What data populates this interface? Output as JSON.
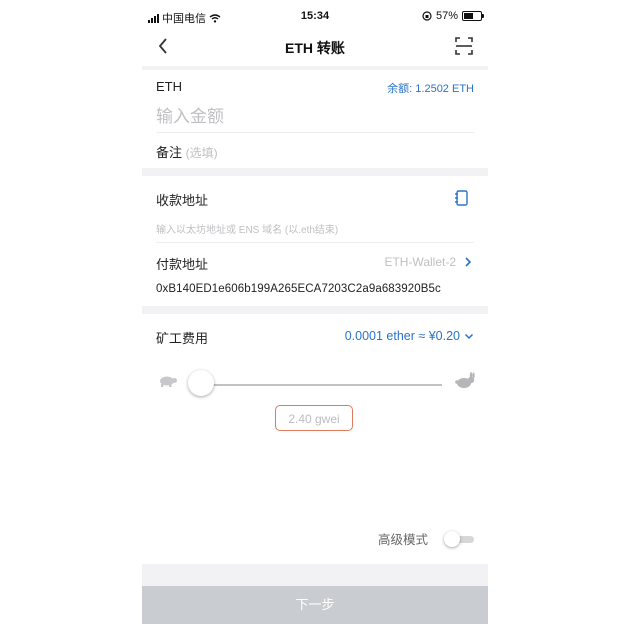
{
  "status_bar": {
    "carrier": "中国电信",
    "time": "15:34",
    "battery": "57%",
    "battery_level": 0.57
  },
  "header": {
    "title": "ETH 转账",
    "back_icon": "chevron-left-icon",
    "scan_icon": "scan-icon"
  },
  "amount": {
    "currency": "ETH",
    "balance": "余额: 1.2502 ETH",
    "placeholder": "输入金额",
    "note_label": "备注",
    "note_placeholder": "(选填)"
  },
  "address": {
    "receive_label": "收款地址",
    "receive_placeholder": "输入以太坊地址或 ENS 域名 (以.eth结束)",
    "contacts_icon": "address-book-icon",
    "pay_label": "付款地址",
    "wallet_name": "ETH-Wallet-2",
    "wallet_address": "0xB140ED1e606b199A265ECA7203C2a9a683920B5c"
  },
  "fee": {
    "label": "矿工费用",
    "value": "0.0001 ether ≈ ¥0.20",
    "gas_price": "2.40 gwei",
    "slider_level": 0.0,
    "slow_icon": "turtle-icon",
    "fast_icon": "rabbit-icon",
    "advanced_label": "高级模式",
    "advanced_on": false
  },
  "footer": {
    "next_label": "下一步"
  },
  "colors": {
    "accent": "#2a73c9",
    "highlight_border": "#e07a5f",
    "disabled_button": "#c9ccd1"
  }
}
